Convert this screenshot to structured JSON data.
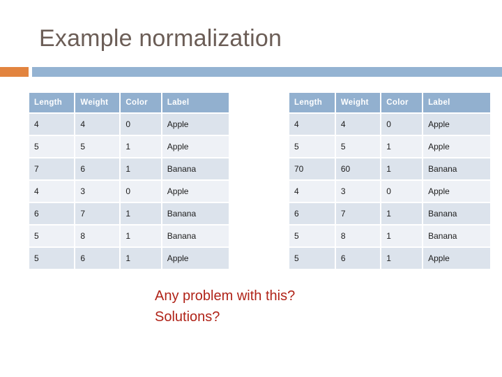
{
  "slide": {
    "title": "Example normalization",
    "accent_orange": "#e2843f",
    "accent_blue": "#94b3d2",
    "title_color": "#6b5d56"
  },
  "tables": {
    "columns": [
      "Length",
      "Weight",
      "Color",
      "Label"
    ],
    "left": {
      "headers": [
        "Length",
        "Weight",
        "Color",
        "Label"
      ],
      "rows": [
        [
          "4",
          "4",
          "0",
          "Apple"
        ],
        [
          "5",
          "5",
          "1",
          "Apple"
        ],
        [
          "7",
          "6",
          "1",
          "Banana"
        ],
        [
          "4",
          "3",
          "0",
          "Apple"
        ],
        [
          "6",
          "7",
          "1",
          "Banana"
        ],
        [
          "5",
          "8",
          "1",
          "Banana"
        ],
        [
          "5",
          "6",
          "1",
          "Apple"
        ]
      ]
    },
    "right": {
      "headers": [
        "Length",
        "Weight",
        "Color",
        "Label"
      ],
      "rows": [
        [
          "4",
          "4",
          "0",
          "Apple"
        ],
        [
          "5",
          "5",
          "1",
          "Apple"
        ],
        [
          "70",
          "60",
          "1",
          "Banana"
        ],
        [
          "4",
          "3",
          "0",
          "Apple"
        ],
        [
          "6",
          "7",
          "1",
          "Banana"
        ],
        [
          "5",
          "8",
          "1",
          "Banana"
        ],
        [
          "5",
          "6",
          "1",
          "Apple"
        ]
      ]
    },
    "header_bg": "#92b0cf",
    "row_odd_bg": "#dce3ec",
    "row_even_bg": "#eef1f6"
  },
  "questions": {
    "line1": "Any problem with this?",
    "line2": "Solutions?",
    "color": "#b02318"
  }
}
